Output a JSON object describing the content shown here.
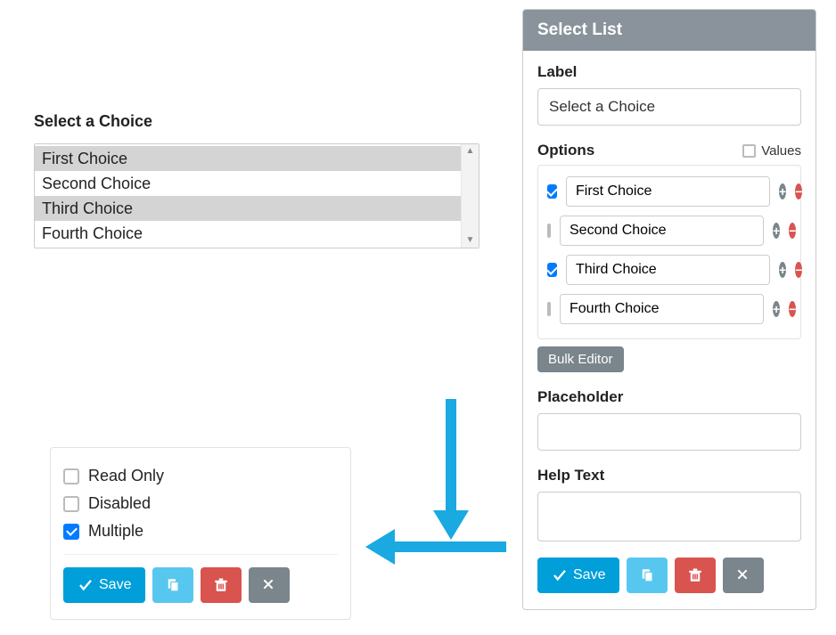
{
  "preview": {
    "label": "Select a Choice",
    "options": [
      {
        "label": "First Choice",
        "selected": true
      },
      {
        "label": "Second Choice",
        "selected": false
      },
      {
        "label": "Third Choice",
        "selected": true
      },
      {
        "label": "Fourth Choice",
        "selected": false
      }
    ]
  },
  "attributes": {
    "read_only": {
      "label": "Read Only",
      "checked": false
    },
    "disabled": {
      "label": "Disabled",
      "checked": false
    },
    "multiple": {
      "label": "Multiple",
      "checked": true
    },
    "save_label": "Save"
  },
  "panel": {
    "title": "Select List",
    "label_heading": "Label",
    "label_value": "Select a Choice",
    "options_heading": "Options",
    "values_label": "Values",
    "values_checked": false,
    "options": [
      {
        "label": "First Choice",
        "checked": true
      },
      {
        "label": "Second Choice",
        "checked": false
      },
      {
        "label": "Third Choice",
        "checked": true
      },
      {
        "label": "Fourth Choice",
        "checked": false
      }
    ],
    "bulk_editor_label": "Bulk Editor",
    "placeholder_heading": "Placeholder",
    "placeholder_value": "",
    "helptext_heading": "Help Text",
    "helptext_value": "",
    "save_label": "Save"
  },
  "colors": {
    "arrow": "#1aa9e1"
  }
}
